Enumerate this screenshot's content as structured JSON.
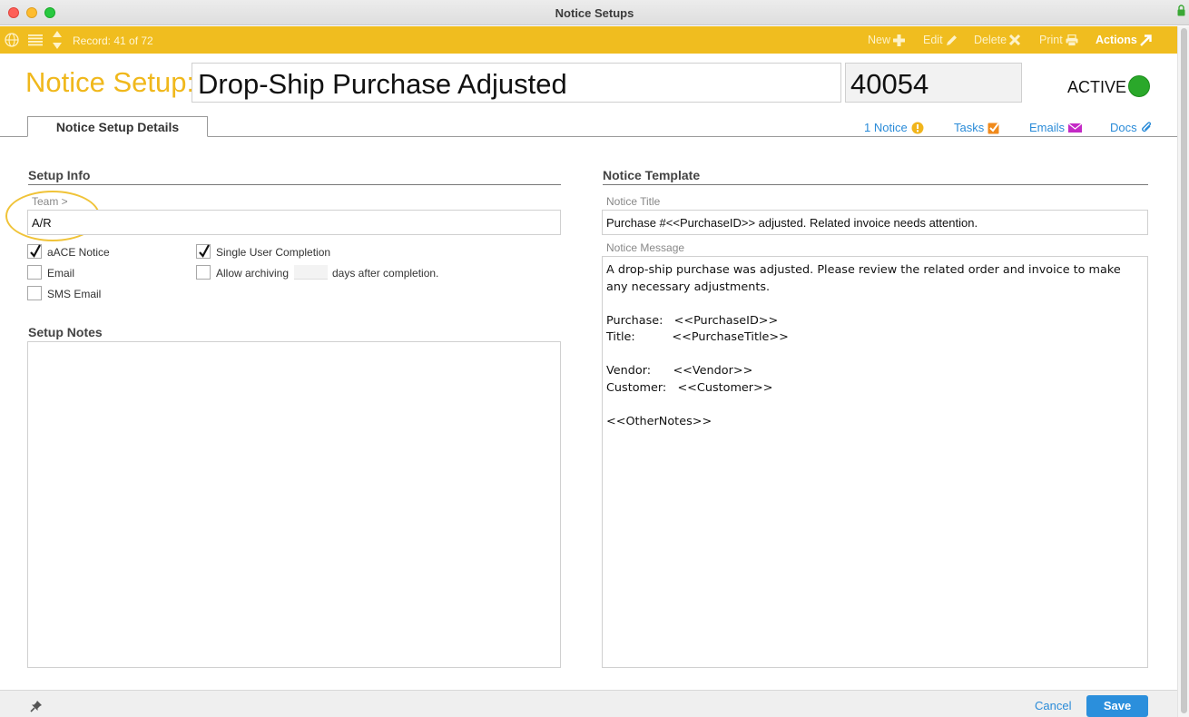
{
  "window": {
    "title": "Notice Setups"
  },
  "toolbar": {
    "record": "Record: 41 of 72",
    "new_label": "New",
    "edit_label": "Edit",
    "delete_label": "Delete",
    "print_label": "Print",
    "actions_label": "Actions"
  },
  "header": {
    "label": "Notice Setup:",
    "name": "Drop-Ship Purchase Adjusted",
    "id": "40054",
    "status": "ACTIVE"
  },
  "tabs": {
    "details": "Notice Setup Details"
  },
  "links": {
    "notice": "1 Notice",
    "tasks": "Tasks",
    "emails": "Emails",
    "docs": "Docs"
  },
  "setup_info": {
    "title": "Setup Info",
    "team_label": "Team >",
    "team_value": "A/R",
    "aace_notice": {
      "label": "aACE Notice",
      "checked": true
    },
    "email": {
      "label": "Email",
      "checked": false
    },
    "sms_email": {
      "label": "SMS Email",
      "checked": false
    },
    "single_user": {
      "label": "Single User Completion",
      "checked": true
    },
    "allow_archiving": {
      "label": "Allow archiving",
      "checked": false
    },
    "days_suffix": "days after completion."
  },
  "setup_notes": {
    "title": "Setup Notes",
    "value": ""
  },
  "notice_template": {
    "title": "Notice Template",
    "notice_title_label": "Notice Title",
    "notice_title_value": "Purchase #<<PurchaseID>> adjusted. Related invoice needs attention.",
    "notice_message_label": "Notice Message",
    "notice_message_value": "A drop-ship purchase was adjusted. Please review the related order and invoice to make any necessary adjustments.\n\nPurchase:   <<PurchaseID>>\nTitle:          <<PurchaseTitle>>\n\nVendor:      <<Vendor>>\nCustomer:   <<Customer>>\n\n<<OtherNotes>>"
  },
  "footer": {
    "cancel_label": "Cancel",
    "save_label": "Save"
  },
  "colors": {
    "toolbar": "#f0bd1f",
    "accent_label": "#f0b81c",
    "active": "#2aa82a",
    "link": "#2a8bd8",
    "save": "#2b8fdc"
  }
}
